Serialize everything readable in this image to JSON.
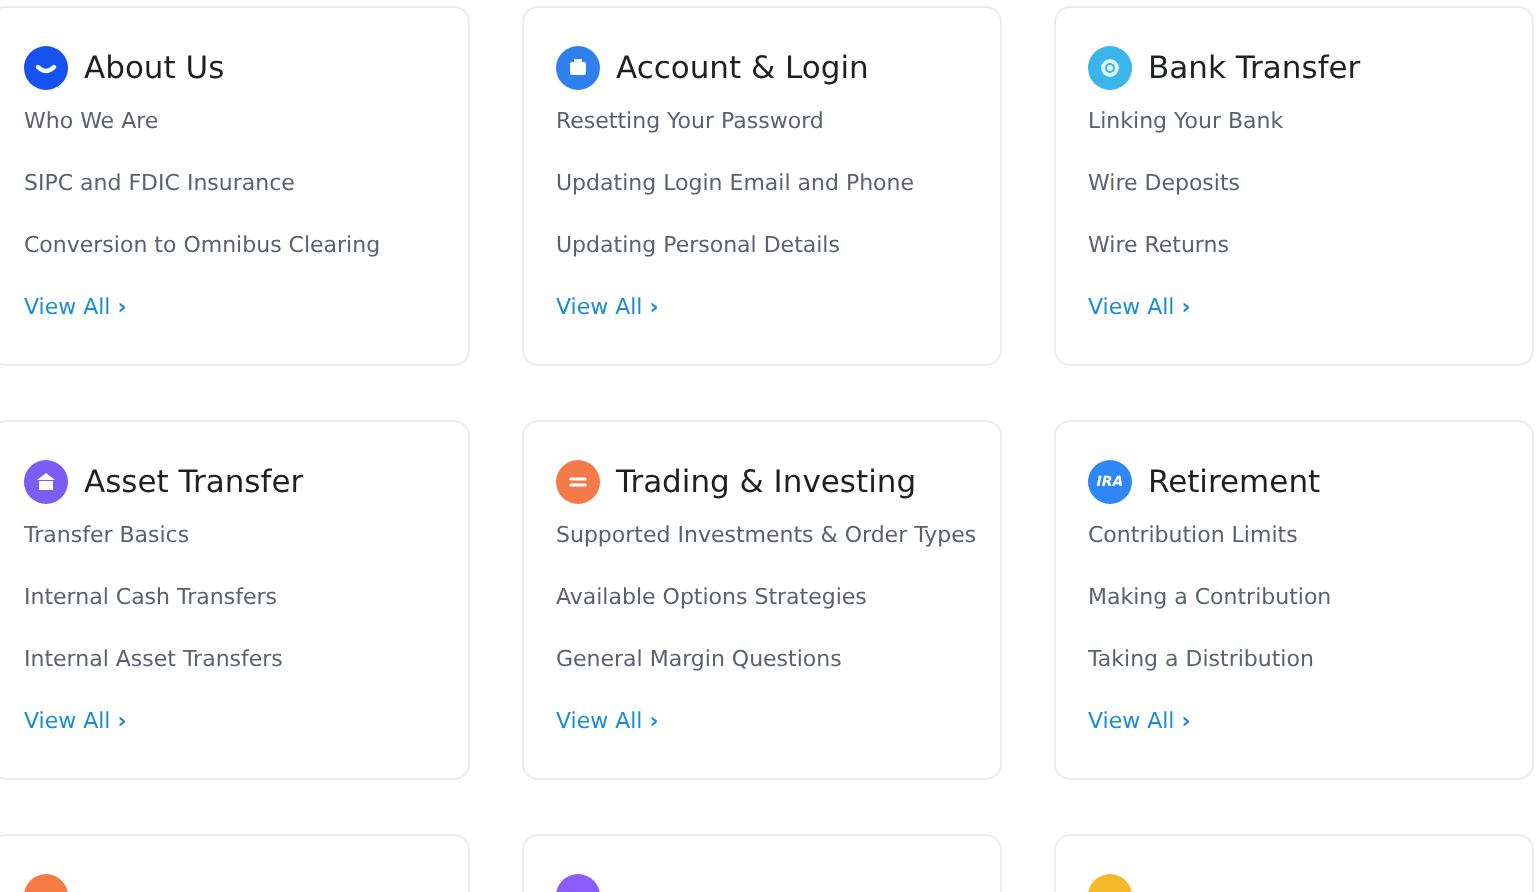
{
  "cards": [
    {
      "title": "About Us",
      "icon": {
        "kind": "smile",
        "color": "#1652f0"
      },
      "links": [
        "Who We Are",
        "SIPC and FDIC Insurance",
        "Conversion to Omnibus Clearing"
      ],
      "view_all": "View All",
      "chevron": "›"
    },
    {
      "title": "Account & Login",
      "icon": {
        "kind": "wallet",
        "color": "#2f80ed"
      },
      "links": [
        "Resetting Your Password",
        "Updating Login Email and Phone",
        "Updating Personal Details"
      ],
      "view_all": "View All",
      "chevron": "›"
    },
    {
      "title": "Bank Transfer",
      "icon": {
        "kind": "coin",
        "color": "#38b6ea"
      },
      "links": [
        "Linking Your Bank",
        "Wire Deposits",
        "Wire Returns"
      ],
      "view_all": "View All",
      "chevron": "›"
    },
    {
      "title": "Asset Transfer",
      "icon": {
        "kind": "bank",
        "color": "#7b5cf5"
      },
      "links": [
        "Transfer Basics",
        "Internal Cash Transfers",
        "Internal Asset Transfers"
      ],
      "view_all": "View All",
      "chevron": "›"
    },
    {
      "title": "Trading & Investing",
      "icon": {
        "kind": "exchange",
        "color": "#f47a4a"
      },
      "links": [
        "Supported Investments & Order Types",
        "Available Options Strategies",
        "General Margin Questions"
      ],
      "view_all": "View All",
      "chevron": "›"
    },
    {
      "title": "Retirement",
      "icon": {
        "kind": "label",
        "color": "#2f86f6",
        "text": "IRA"
      },
      "links": [
        "Contribution Limits",
        "Making a Contribution",
        "Taking a Distribution"
      ],
      "view_all": "View All",
      "chevron": "›"
    },
    {
      "icon": {
        "kind": "plain",
        "color": "#f57c45"
      }
    },
    {
      "icon": {
        "kind": "plain",
        "color": "#8b5cf6"
      }
    },
    {
      "icon": {
        "kind": "plain",
        "color": "#f5b82a"
      }
    }
  ]
}
